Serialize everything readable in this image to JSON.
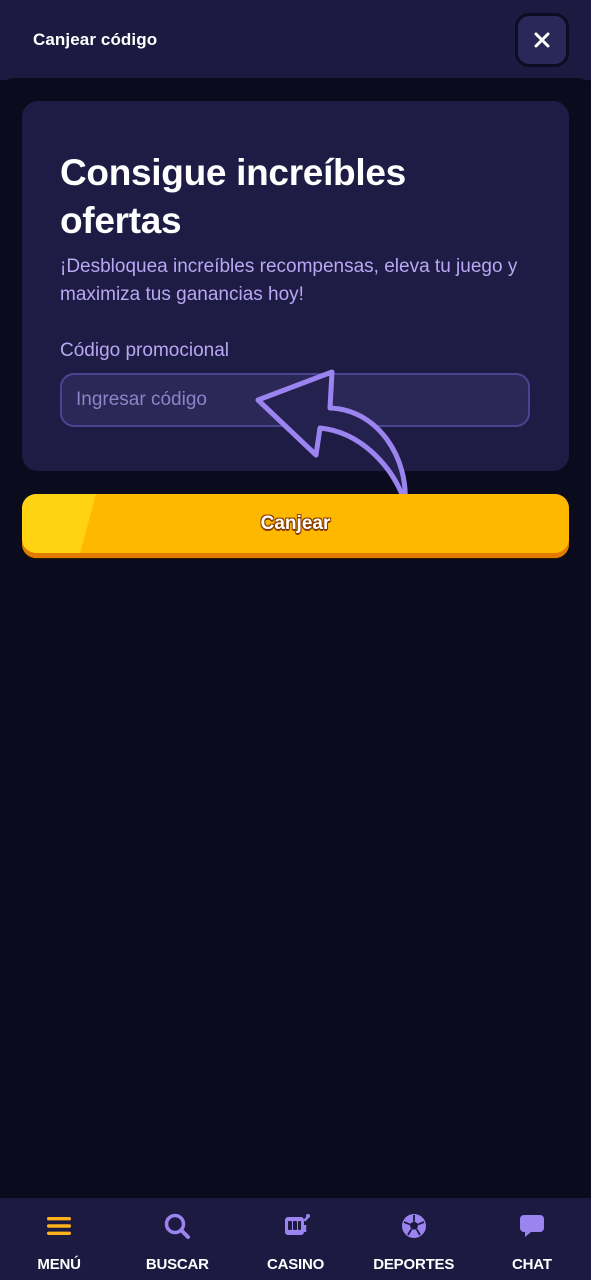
{
  "header": {
    "title": "Canjear código",
    "close_icon": "close-icon"
  },
  "promo_card": {
    "title": "Consigue increíbles ofertas",
    "subtitle": "¡Desbloquea increíbles recompensas, eleva tu juego y maximiza tus ganancias hoy!",
    "field_label": "Código promocional",
    "input_placeholder": "Ingresar código",
    "input_value": ""
  },
  "redeem_button": {
    "label": "Canjear"
  },
  "hint": {
    "icon": "curved-arrow-icon"
  },
  "bottom_nav": {
    "items": [
      {
        "label": "MENÚ",
        "icon": "menu-icon"
      },
      {
        "label": "BUSCAR",
        "icon": "search-icon"
      },
      {
        "label": "CASINO",
        "icon": "slot-machine-icon"
      },
      {
        "label": "DEPORTES",
        "icon": "soccer-ball-icon"
      },
      {
        "label": "CHAT",
        "icon": "chat-icon"
      }
    ]
  },
  "colors": {
    "background": "#0b0b1e",
    "panel": "#1c1a40",
    "card": "#1e1c44",
    "accent_purple": "#b9a7f3",
    "icon_purple": "#9c84f0",
    "button_yellow": "#ffb800",
    "menu_orange": "#ffb21a"
  }
}
